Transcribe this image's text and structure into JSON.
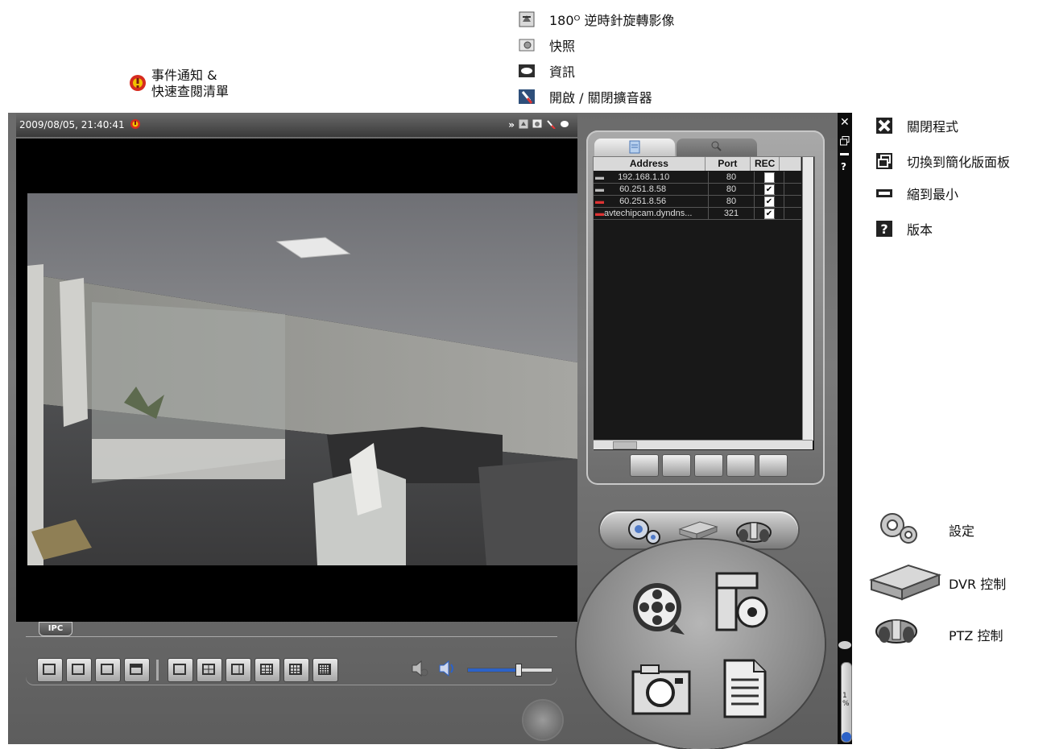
{
  "annotations": {
    "top": {
      "rotate": "180ᴼ 逆時針旋轉影像",
      "snapshot": "快照",
      "info": "資訊",
      "speaker": "開啟 / 關閉擴音器"
    },
    "event": "事件通知 &\n快速查閱清單",
    "right": {
      "close": "關閉程式",
      "switch": "切換到簡化版面板",
      "minimize": "縮到最小",
      "version": "版本"
    },
    "controls": {
      "settings": "設定",
      "dvr": "DVR 控制",
      "ptz": "PTZ 控制"
    }
  },
  "app": {
    "timestamp": "2009/08/05, 21:40:41",
    "ipc_label": "IPC",
    "zoom_label": "1\n%",
    "table": {
      "headers": [
        "Address",
        "Port",
        "REC"
      ],
      "rows": [
        {
          "address": "192.168.1.10",
          "port": "80",
          "rec": false
        },
        {
          "address": "60.251.8.58",
          "port": "80",
          "rec": true
        },
        {
          "address": "60.251.8.56",
          "port": "80",
          "rec": true
        },
        {
          "address": "avtechipcam.dyndns...",
          "port": "321",
          "rec": true
        }
      ]
    },
    "volume_fraction": 0.6
  },
  "colors": {
    "alert": "#d62b1f",
    "alert_center": "#f2c200",
    "checkbox": "#ffffff",
    "volume_blue": "#2c62c8"
  }
}
